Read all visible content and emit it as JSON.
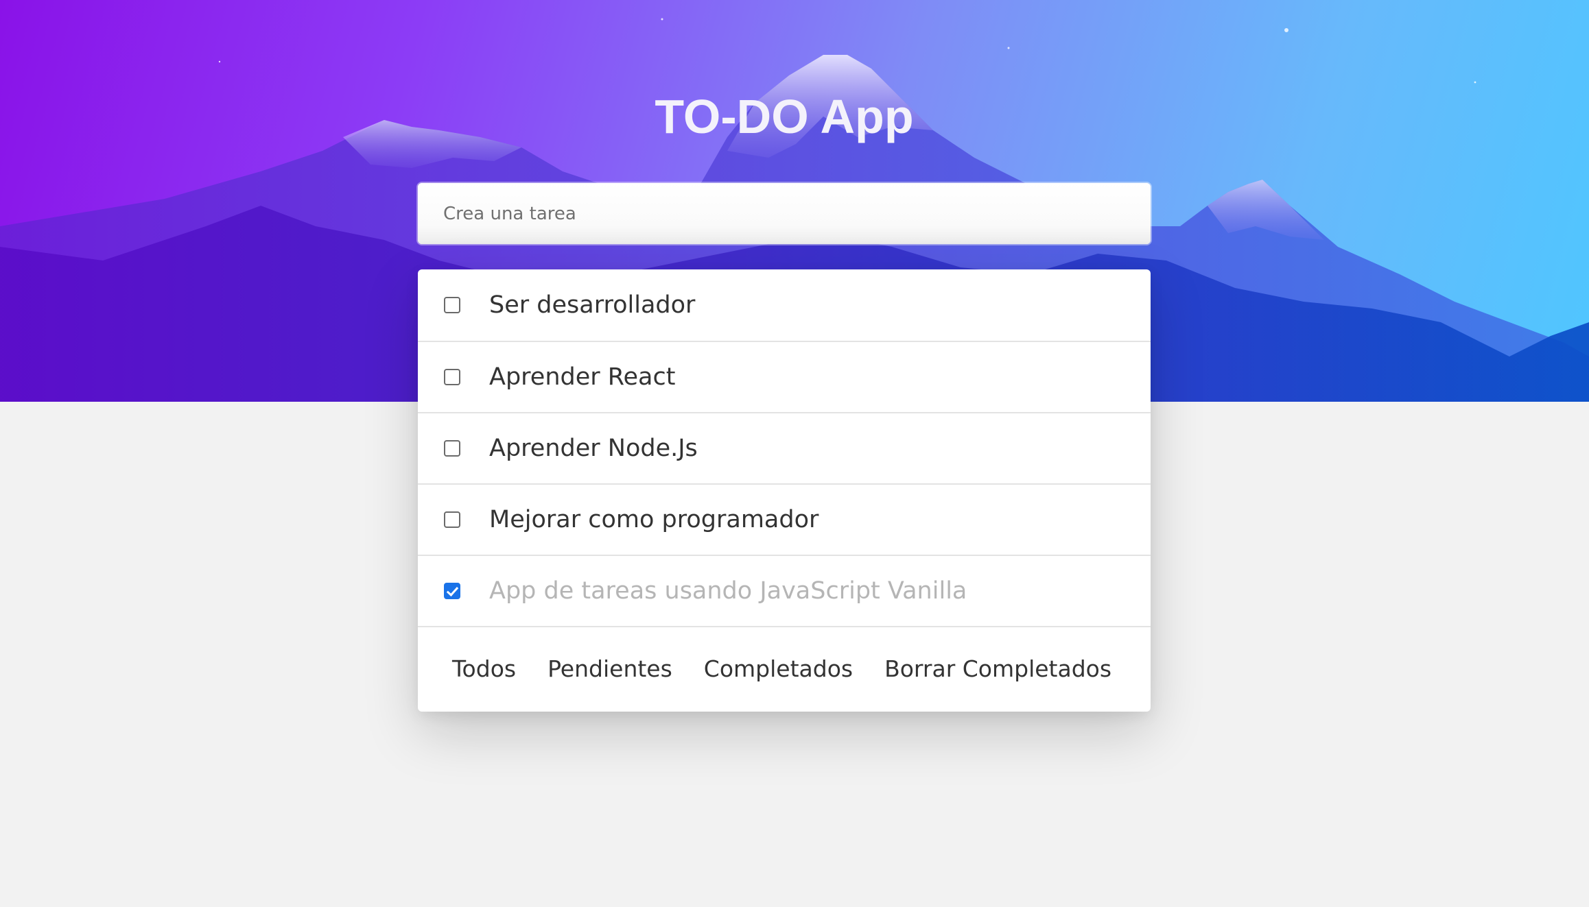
{
  "app": {
    "title": "TO-DO App"
  },
  "new_task": {
    "placeholder": "Crea una tarea",
    "value": ""
  },
  "todos": [
    {
      "label": "Ser desarrollador",
      "completed": false
    },
    {
      "label": "Aprender React",
      "completed": false
    },
    {
      "label": "Aprender Node.Js",
      "completed": false
    },
    {
      "label": "Mejorar como programador",
      "completed": false
    },
    {
      "label": "App de tareas usando JavaScript Vanilla",
      "completed": true
    }
  ],
  "filters": {
    "all": "Todos",
    "pending": "Pendientes",
    "completed": "Completados",
    "clear_completed": "Borrar Completados"
  },
  "colors": {
    "hero_gradient_start": "#8a12e8",
    "hero_gradient_end": "#4fc6ff",
    "checkbox_accent": "#1a73e8",
    "page_background": "#f2f2f2"
  }
}
